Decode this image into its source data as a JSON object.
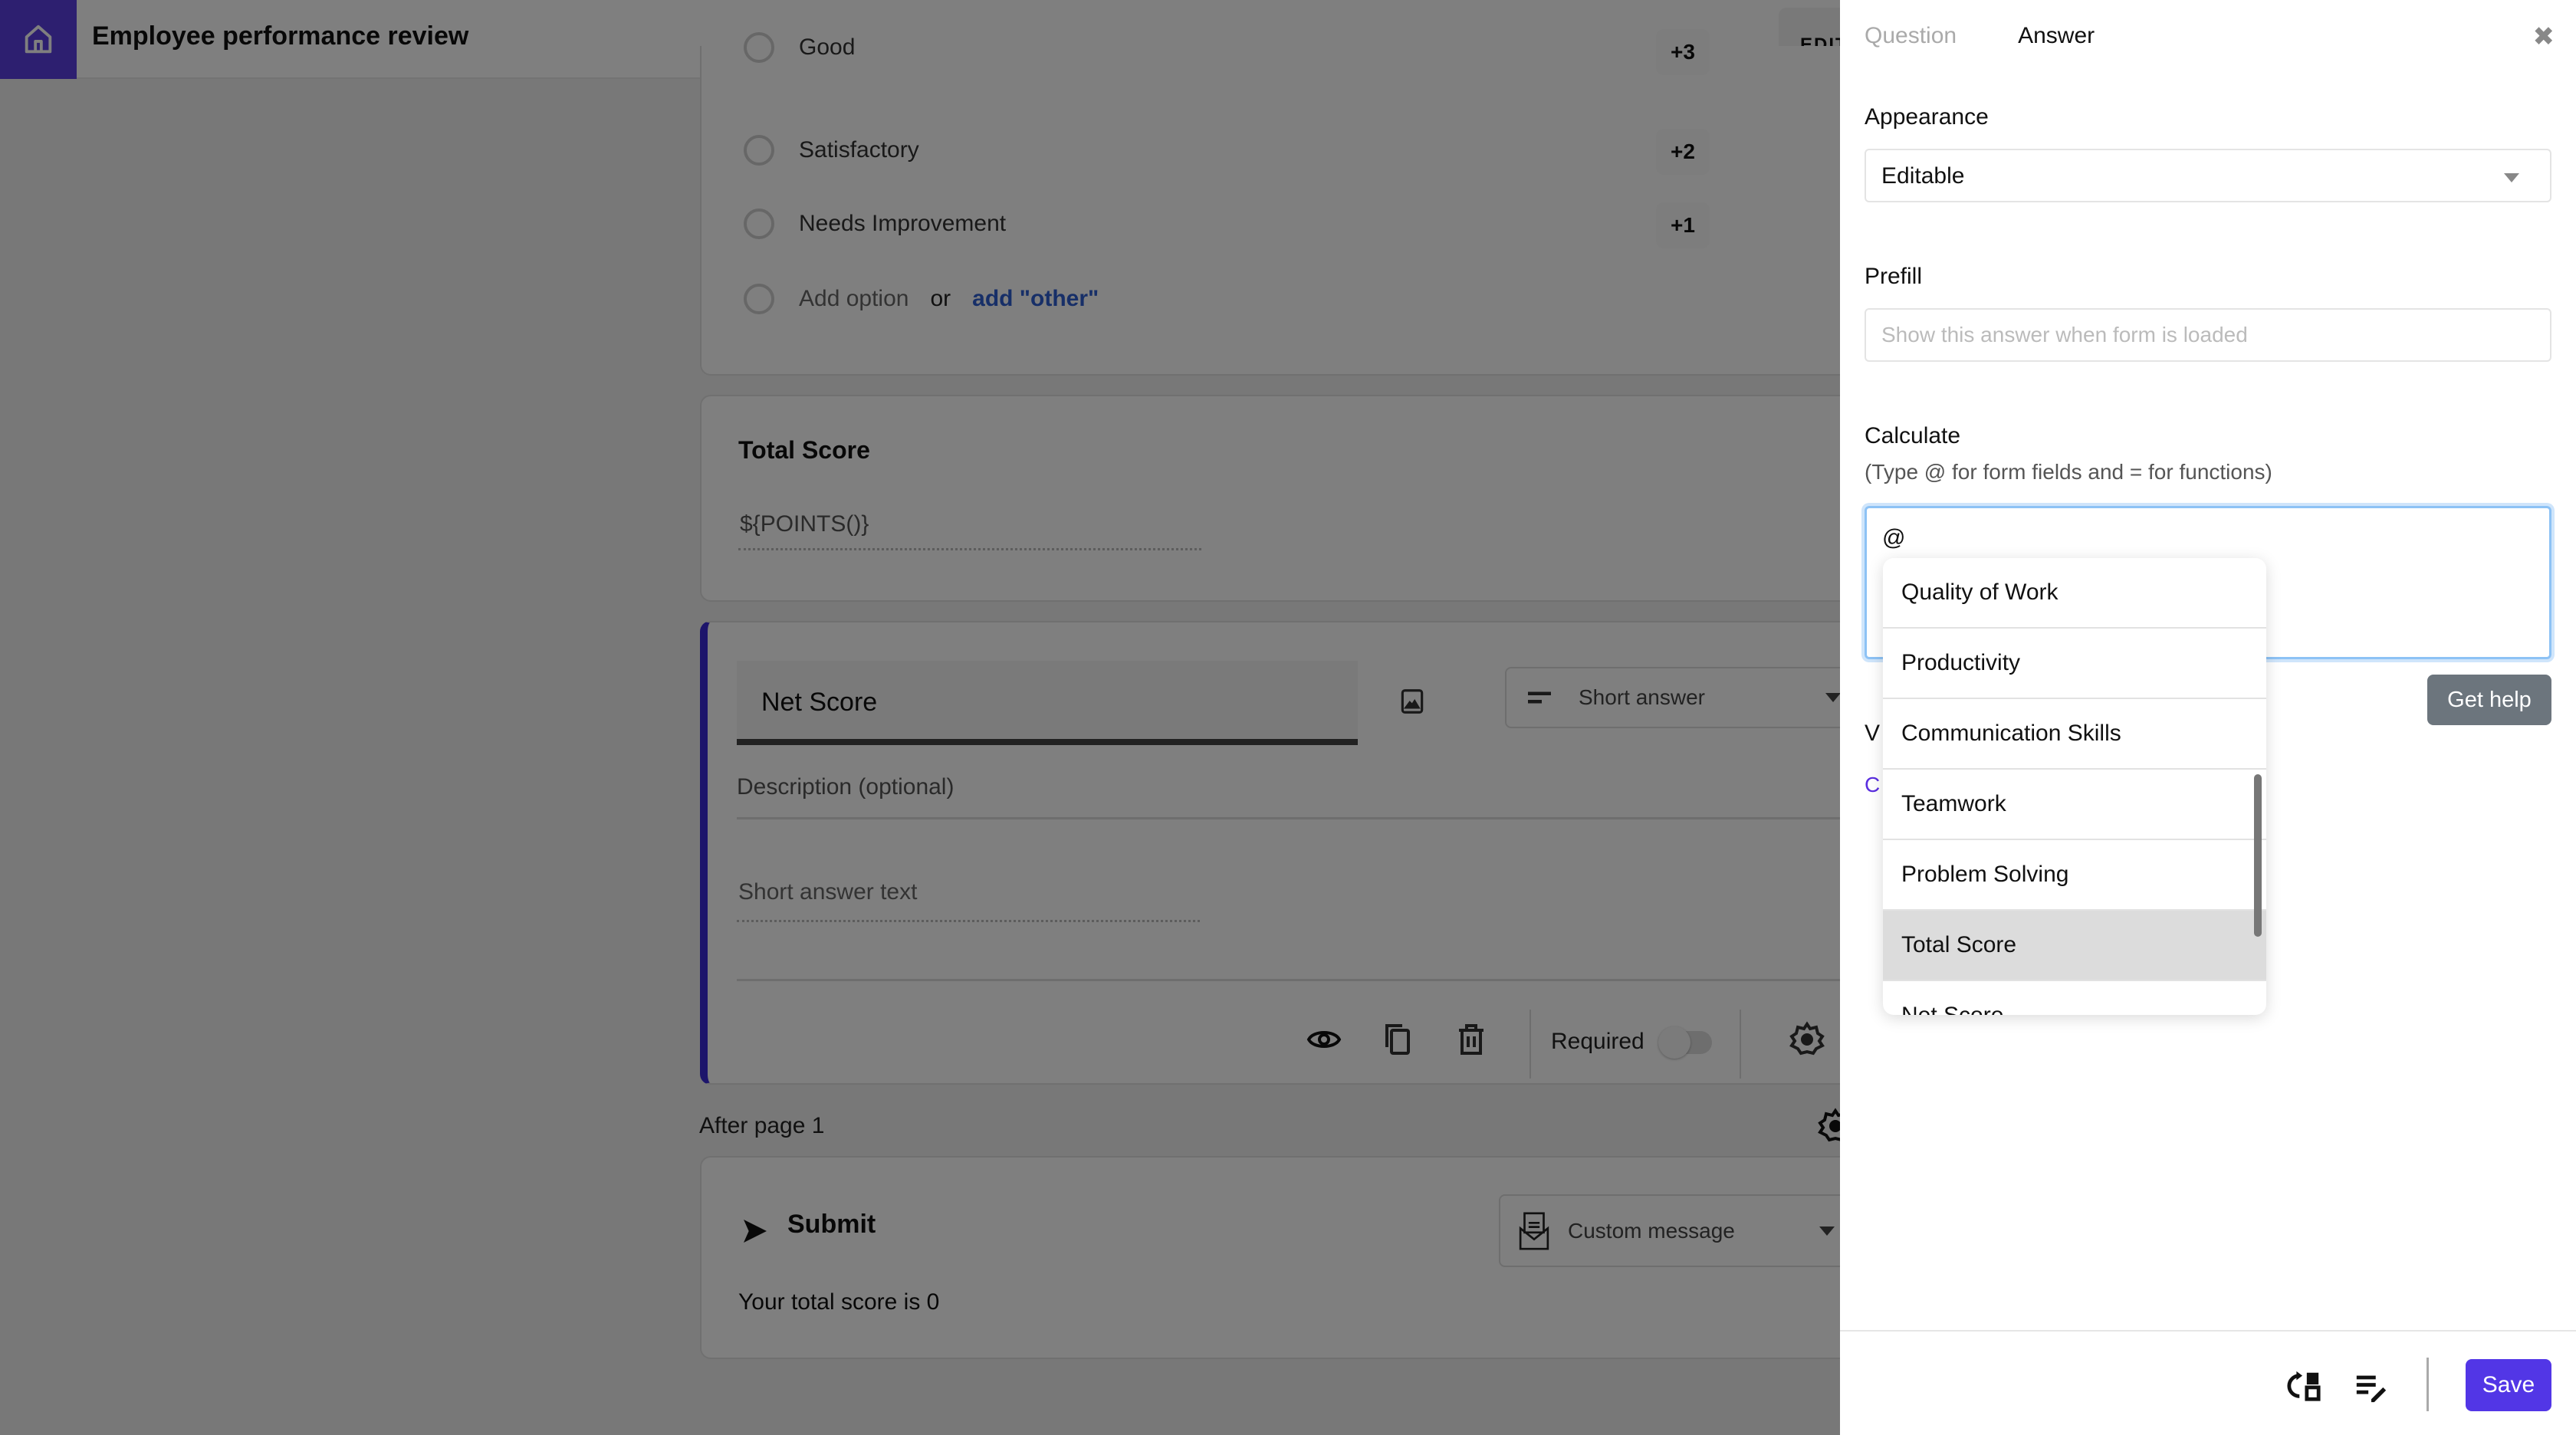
{
  "header": {
    "app_title": "Employee performance review",
    "edit_tab": "EDIT",
    "home_icon": "home-icon"
  },
  "colors": {
    "brand": "#5a3fe0",
    "save_button": "#5236e6",
    "focus_ring": "#8dc2f5",
    "get_help_button": "#6c757d",
    "accent_bar": "#3b2bd6"
  },
  "options_card": {
    "options": [
      {
        "label": "Good",
        "points": "+3"
      },
      {
        "label": "Satisfactory",
        "points": "+2"
      },
      {
        "label": "Needs Improvement",
        "points": "+1"
      }
    ],
    "add_option": "Add option",
    "or": "or",
    "add_other": "add \"other\""
  },
  "total_card": {
    "title": "Total Score",
    "formula": "${POINTS()}"
  },
  "net_card": {
    "title": "Net Score",
    "type_select": "Short answer",
    "description_placeholder": "Description (optional)",
    "answer_placeholder": "Short answer text",
    "required_label": "Required",
    "required_on": false
  },
  "after_page": {
    "label": "After page 1"
  },
  "submit_card": {
    "title": "Submit",
    "action_select": "Custom message",
    "message": "Your total score is 0"
  },
  "panel": {
    "tabs": [
      {
        "label": "Question",
        "active": false
      },
      {
        "label": "Answer",
        "active": true
      }
    ],
    "close_icon": "close-icon",
    "appearance": {
      "label": "Appearance",
      "value": "Editable"
    },
    "prefill": {
      "label": "Prefill",
      "placeholder": "Show this answer when form is loaded"
    },
    "calculate": {
      "label": "Calculate",
      "hint": "(Type @ for form fields and = for functions)",
      "value": "@"
    },
    "get_help": "Get help",
    "hidden_label_partial": "V",
    "hidden_link_partial": "C",
    "mention_options": [
      "Quality of Work",
      "Productivity",
      "Communication Skills",
      "Teamwork",
      "Problem Solving",
      "Total Score",
      "Net Score"
    ],
    "mention_highlighted_index": 5,
    "footer": {
      "save": "Save"
    }
  }
}
